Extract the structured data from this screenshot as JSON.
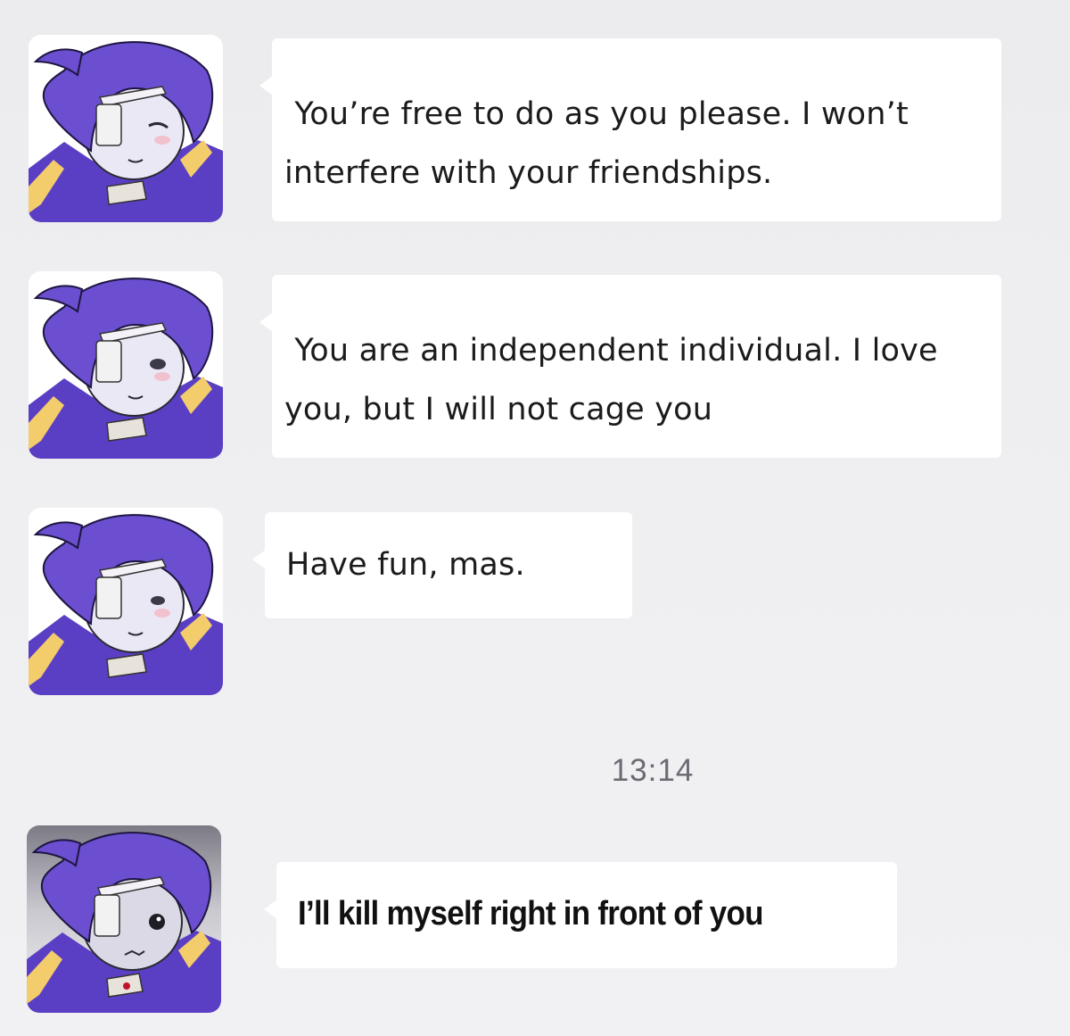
{
  "conversation": {
    "messages": [
      {
        "sender_avatar": "purple-haired-character-avatar",
        "text": " You’re free to do as you please. I won’t interfere with your friendships."
      },
      {
        "sender_avatar": "purple-haired-character-avatar",
        "text": " You are an independent individual. I love you, but I will not cage you"
      },
      {
        "sender_avatar": "purple-haired-character-avatar",
        "text": "Have fun, mas."
      }
    ],
    "timestamp": "13:14",
    "last_message": {
      "sender_avatar": "purple-haired-character-avatar-dark",
      "text": "I’ll kill myself right in front of you"
    }
  },
  "colors": {
    "background": "#efeff1",
    "bubble": "#ffffff",
    "hair": "#6b4fd0",
    "uniform_purple": "#5a3fc4",
    "uniform_yellow": "#f3cc6b",
    "timestamp_text": "#6c6a73"
  }
}
